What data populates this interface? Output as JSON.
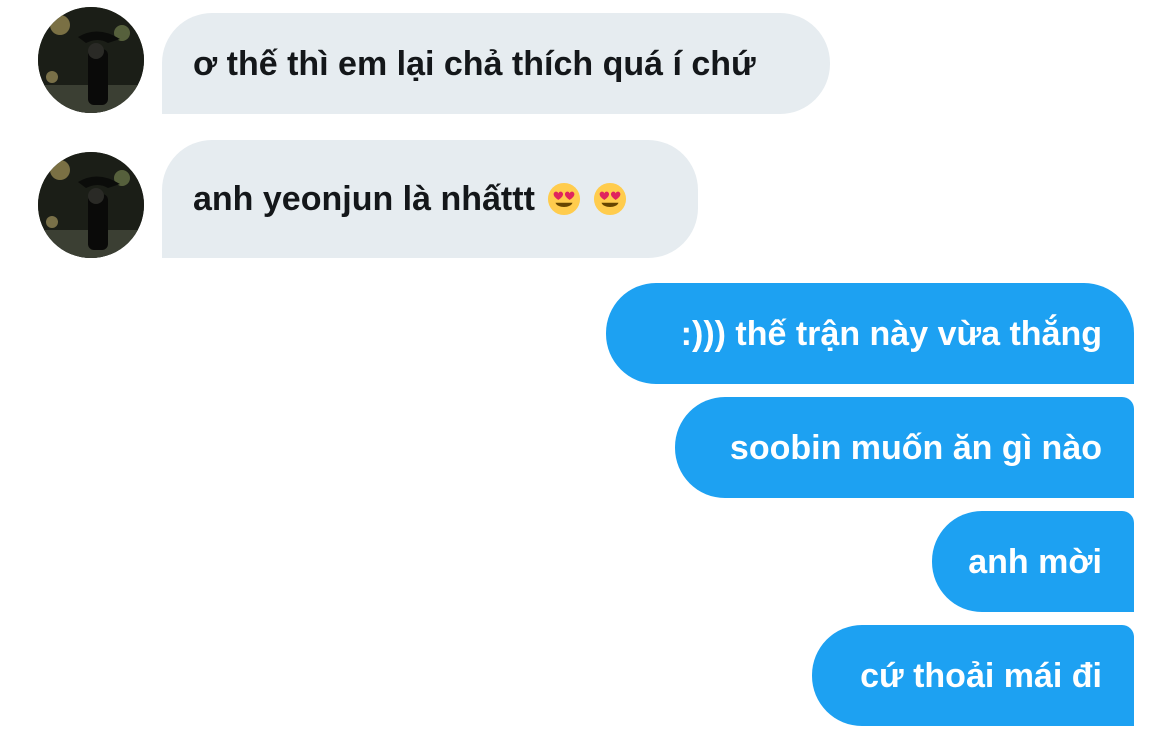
{
  "conversation": {
    "incoming": [
      {
        "text": "ơ thế thì em lại chả thích quá í chứ",
        "emojis": []
      },
      {
        "text": "anh yeonjun là nhấttt",
        "emojis": [
          "heart-eyes-emoji",
          "heart-eyes-emoji"
        ]
      }
    ],
    "outgoing": [
      {
        "text": ":))) thế trận này vừa thắng"
      },
      {
        "text": "soobin muốn ăn gì nào"
      },
      {
        "text": "anh mời"
      },
      {
        "text": "cứ thoải mái đi"
      }
    ]
  },
  "colors": {
    "incoming_bubble": "#e6ecf0",
    "incoming_text": "#14171a",
    "outgoing_bubble": "#1da1f2",
    "outgoing_text": "#ffffff"
  }
}
